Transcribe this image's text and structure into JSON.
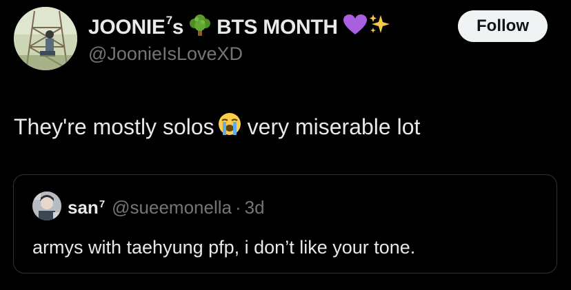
{
  "author": {
    "display_name": "JOONIE",
    "name_superscript": "7",
    "name_suffix": "s",
    "name_tail": "BTS MONTH",
    "handle": "@JoonieIsLoveXD",
    "emoji_1": "tree-emoji",
    "emoji_2": "purple-heart-emoji",
    "emoji_3": "sparkles-emoji"
  },
  "follow_button": {
    "label": "Follow"
  },
  "tweet": {
    "text_before_emoji": "They're mostly solos",
    "emoji": "loudly-crying-face-emoji",
    "text_after_emoji": "very miserable lot"
  },
  "quoted_tweet": {
    "display_name": "san",
    "name_superscript": "7",
    "handle": "@sueemonella",
    "separator": "·",
    "time": "3d",
    "text": "armys with taehyung pfp, i don’t like your tone."
  },
  "colors": {
    "background": "#000000",
    "primary_text": "#e7e9ea",
    "secondary_text": "#71767b",
    "border": "#2f3336",
    "follow_bg": "#eff3f4"
  }
}
